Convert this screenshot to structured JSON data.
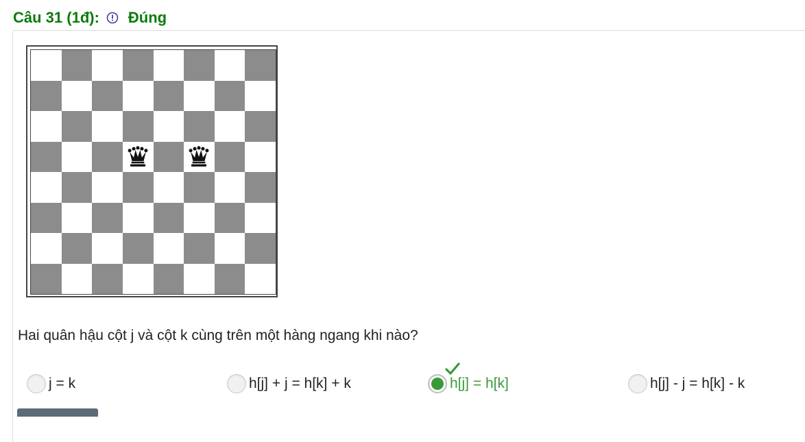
{
  "question": {
    "title": "Câu 31 (1đ):",
    "info_icon": "info-circle-icon",
    "status": "Đúng",
    "status_color": "#0d7a0d",
    "prompt": "Hai quân hậu cột j và cột k cùng trên một hàng ngang khi nào?"
  },
  "board": {
    "size": 8,
    "dark_color": "#8c8c8c",
    "light_color": "#ffffff",
    "queens": [
      {
        "row": 4,
        "col": 4,
        "piece": "queen-icon"
      },
      {
        "row": 4,
        "col": 6,
        "piece": "queen-icon"
      }
    ]
  },
  "options": [
    {
      "label": "j = k",
      "selected": false,
      "correct": false
    },
    {
      "label": "h[j] + j = h[k] + k",
      "selected": false,
      "correct": false
    },
    {
      "label": "h[j] = h[k]",
      "selected": true,
      "correct": true
    },
    {
      "label": "h[j] - j = h[k] - k",
      "selected": false,
      "correct": false
    }
  ],
  "colors": {
    "correct_green": "#3a9a3a"
  }
}
